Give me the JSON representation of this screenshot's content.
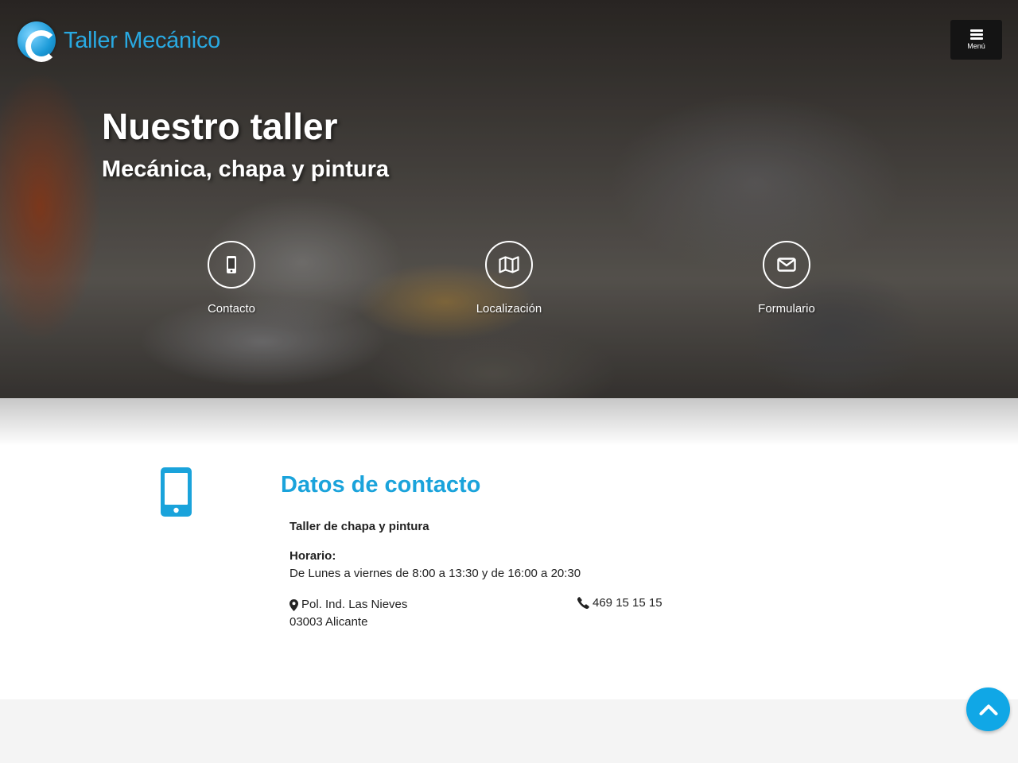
{
  "brand": {
    "name": "Taller Mecánico",
    "color": "#29a9e1"
  },
  "nav": {
    "menu_label": "Menú"
  },
  "hero": {
    "title": "Nuestro taller",
    "subtitle": "Mecánica, chapa y pintura",
    "links": [
      {
        "label": "Contacto",
        "icon": "mobile-phone-icon"
      },
      {
        "label": "Localización",
        "icon": "map-icon"
      },
      {
        "label": "Formulario",
        "icon": "envelope-icon"
      }
    ]
  },
  "contact": {
    "heading": "Datos de contacto",
    "icon": "mobile-phone-icon",
    "business_name": "Taller de chapa y pintura",
    "hours_label": "Horario:",
    "hours": "De Lunes a viernes de 8:00 a 13:30 y de 16:00 a 20:30",
    "address_line1": "Pol. Ind. Las Nieves",
    "address_line2": "03003 Alicante",
    "phone": "469 15 15 15",
    "accent_color": "#1aa3db"
  },
  "scroll_top": {
    "icon": "chevron-up-icon",
    "color": "#10a7e6"
  }
}
